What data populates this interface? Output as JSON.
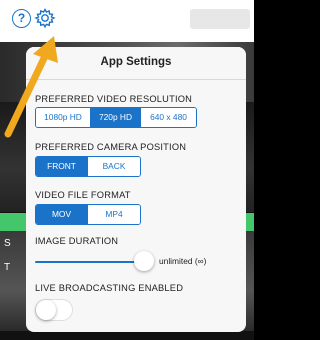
{
  "colors": {
    "accent": "#1a73c9",
    "arrow": "#f0a81e",
    "green_bar": "#44c76a"
  },
  "topbar": {
    "help_icon": "?",
    "settings_icon": "gear-icon"
  },
  "popover": {
    "title": "App Settings"
  },
  "sections": {
    "resolution": {
      "label": "PREFERRED VIDEO RESOLUTION",
      "options": [
        "1080p HD",
        "720p HD",
        "640 x 480"
      ],
      "selected": "720p HD"
    },
    "camera": {
      "label": "PREFERRED CAMERA POSITION",
      "options": [
        "FRONT",
        "BACK"
      ],
      "selected": "FRONT"
    },
    "format": {
      "label": "VIDEO FILE FORMAT",
      "options": [
        "MOV",
        "MP4"
      ],
      "selected": "MOV"
    },
    "duration": {
      "label": "IMAGE DURATION",
      "value_text": "unlimited (∞)",
      "level": 1.0
    },
    "live": {
      "label": "LIVE BROADCASTING ENABLED",
      "enabled": false
    }
  },
  "background": {
    "edge_char_1": "S",
    "edge_char_2": "T"
  }
}
